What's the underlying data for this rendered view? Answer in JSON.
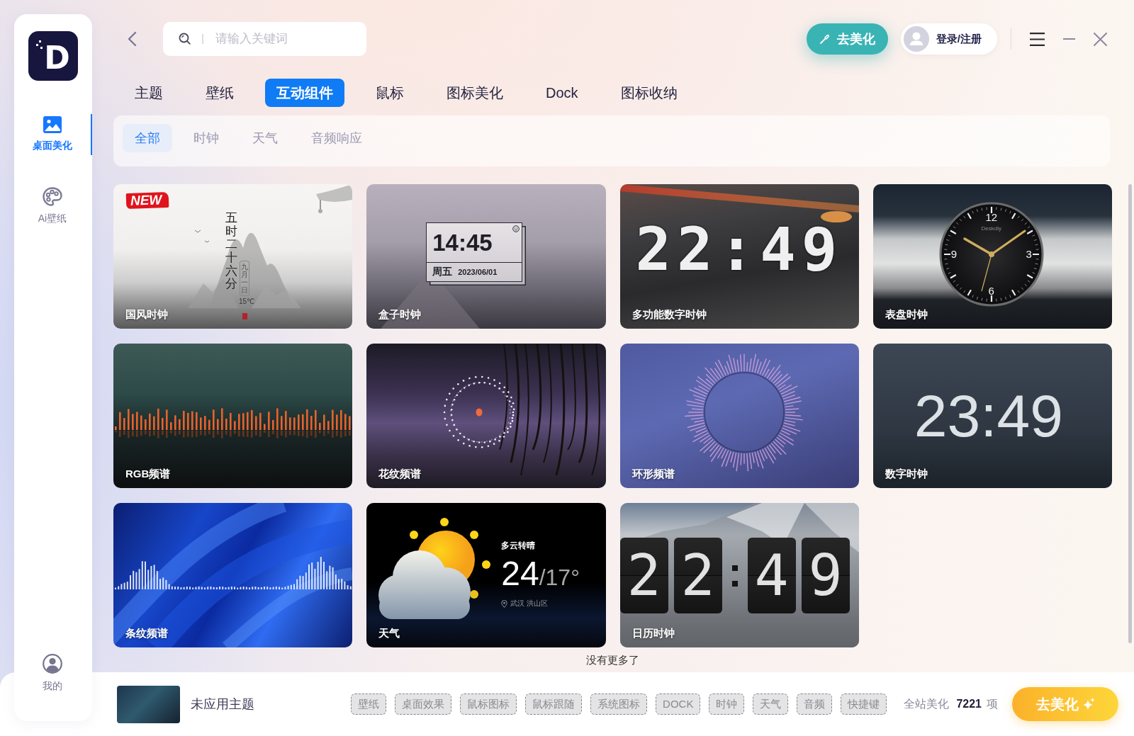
{
  "sidebar": {
    "logo": "D",
    "nav": [
      {
        "label": "桌面美化",
        "selected": true
      },
      {
        "label": "Ai壁纸",
        "selected": false
      }
    ],
    "profile": "我的"
  },
  "header": {
    "search": {
      "placeholder": "请输入关键词"
    },
    "beautify_button": "去美化",
    "login_button": "登录/注册"
  },
  "tabs": [
    {
      "label": "主题",
      "selected": false
    },
    {
      "label": "壁纸",
      "selected": false
    },
    {
      "label": "互动组件",
      "selected": true
    },
    {
      "label": "鼠标",
      "selected": false
    },
    {
      "label": "图标美化",
      "selected": false
    },
    {
      "label": "Dock",
      "selected": false
    },
    {
      "label": "图标收纳",
      "selected": false
    }
  ],
  "filters": [
    {
      "label": "全部",
      "selected": true
    },
    {
      "label": "时钟",
      "selected": false
    },
    {
      "label": "天气",
      "selected": false
    },
    {
      "label": "音频响应",
      "selected": false
    }
  ],
  "cards": [
    {
      "kind": "ink",
      "title": "国风时钟",
      "badge": "NEW",
      "vertical_text": "五时二十六分",
      "date": "九月一日",
      "temp": "15℃"
    },
    {
      "kind": "box",
      "title": "盒子时钟",
      "time": "14:45",
      "weekday": "周五",
      "date": "2023/06/01"
    },
    {
      "kind": "segment",
      "title": "多功能数字时钟",
      "time": "22:49"
    },
    {
      "kind": "dial",
      "title": "表盘时钟",
      "numerals": [
        "12",
        "3",
        "6",
        "9"
      ],
      "brand": "Deskdiy"
    },
    {
      "kind": "bars",
      "title": "RGB频谱"
    },
    {
      "kind": "ring",
      "title": "花纹频谱"
    },
    {
      "kind": "radial",
      "title": "环形频谱"
    },
    {
      "kind": "digital",
      "title": "数字时钟",
      "time": "23:49"
    },
    {
      "kind": "wave",
      "title": "条纹频谱"
    },
    {
      "kind": "weather",
      "title": "天气",
      "condition": "多云转晴",
      "high": "24",
      "low": "/17°",
      "location": "武汉 洪山区"
    },
    {
      "kind": "flip",
      "title": "日历时钟",
      "digits": [
        "2",
        "2",
        "4",
        "9"
      ]
    }
  ],
  "end_note": "没有更多了",
  "footer": {
    "theme_name": "未应用主题",
    "tags": [
      "壁纸",
      "桌面效果",
      "鼠标图标",
      "鼠标跟随",
      "系统图标",
      "DOCK",
      "时钟",
      "天气",
      "音频",
      "快捷键"
    ],
    "total_label": "全站美化",
    "total_count": "7221",
    "total_unit": "项",
    "apply_button": "去美化"
  }
}
